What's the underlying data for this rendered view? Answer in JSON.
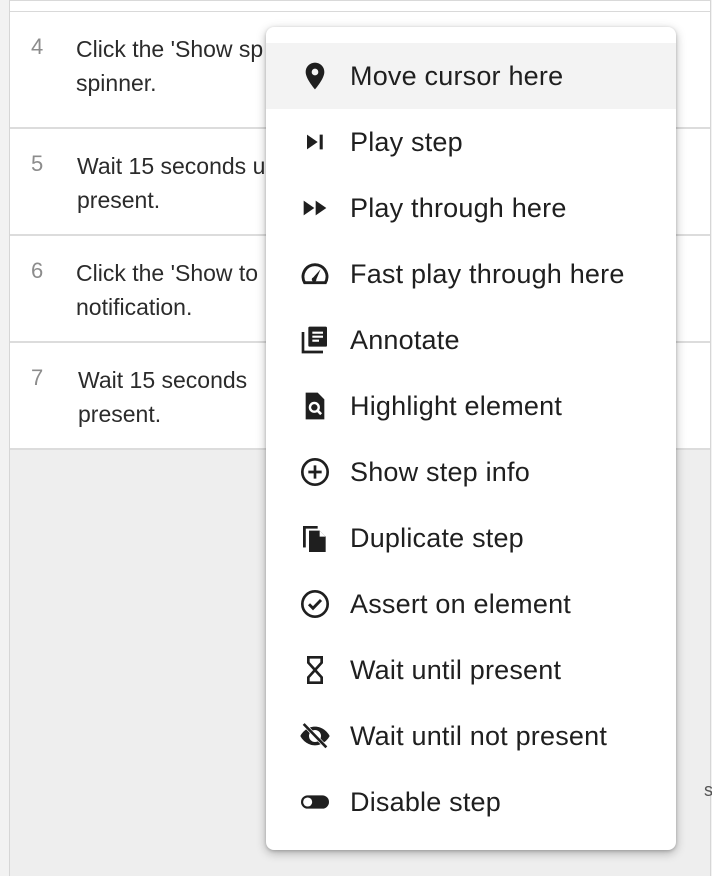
{
  "steps": [
    {
      "number": "4",
      "text": "Click the 'Show sp\nspinner."
    },
    {
      "number": "5",
      "text": "Wait 15 seconds u\npresent."
    },
    {
      "number": "6",
      "text": "Click the 'Show to\nnotification."
    },
    {
      "number": "7",
      "text": "Wait 15 seconds\npresent."
    }
  ],
  "menu": {
    "items": [
      {
        "label": "Move cursor here",
        "icon": "location-pin-icon",
        "active": true
      },
      {
        "label": "Play step",
        "icon": "skip-next-icon"
      },
      {
        "label": "Play through here",
        "icon": "fast-forward-icon"
      },
      {
        "label": "Fast play through here",
        "icon": "speedometer-icon"
      },
      {
        "label": "Annotate",
        "icon": "notes-stack-icon"
      },
      {
        "label": "Highlight element",
        "icon": "document-search-icon"
      },
      {
        "label": "Show step info",
        "icon": "plus-circle-icon"
      },
      {
        "label": "Duplicate step",
        "icon": "copy-icon"
      },
      {
        "label": "Assert on element",
        "icon": "check-circle-icon"
      },
      {
        "label": "Wait until present",
        "icon": "hourglass-icon"
      },
      {
        "label": "Wait until not present",
        "icon": "eye-off-icon"
      },
      {
        "label": "Disable step",
        "icon": "toggle-off-icon"
      }
    ]
  },
  "edge_glyph": "s",
  "colors": {
    "menu_bg": "#ffffff",
    "active_item_bg": "#f3f3f3",
    "text": "#1f1f1f",
    "step_number": "#8c8c8c",
    "panel_bg": "#eeeeee"
  }
}
